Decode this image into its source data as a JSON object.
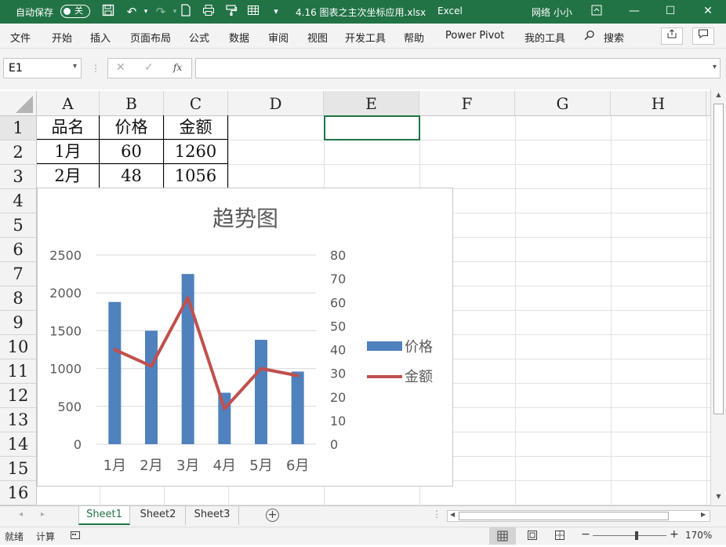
{
  "titlebar": {
    "autosave_label": "自动保存",
    "autosave_state": "关",
    "filename": "4.16 图表之主次坐标应用.xlsx",
    "app": "Excel",
    "user": "网络 小小",
    "color": "#217346"
  },
  "menu": [
    "文件",
    "开始",
    "插入",
    "页面布局",
    "公式",
    "数据",
    "审阅",
    "视图",
    "开发工具",
    "帮助",
    "Power Pivot",
    "我的工具",
    "搜索"
  ],
  "formula_bar": {
    "name_box": "E1",
    "fx": "fx",
    "formula": ""
  },
  "columns": [
    "A",
    "B",
    "C",
    "D",
    "E",
    "F",
    "G",
    "H"
  ],
  "rows": [
    "1",
    "2",
    "3",
    "4",
    "5",
    "6",
    "7",
    "8",
    "9",
    "10",
    "11",
    "12",
    "13",
    "14",
    "15",
    "16"
  ],
  "cells": {
    "A1": "品名",
    "B1": "价格",
    "C1": "金额",
    "A2": "1月",
    "B2": "60",
    "C2": "1260",
    "A3": "2月",
    "B3": "48",
    "C3": "1056"
  },
  "chart_data": {
    "type": "bar",
    "title": "趋势图",
    "categories": [
      "1月",
      "2月",
      "3月",
      "4月",
      "5月",
      "6月"
    ],
    "series": [
      {
        "name": "价格",
        "type": "bar",
        "axis": "primary",
        "values": [
          1880,
          1500,
          2250,
          680,
          1380,
          960
        ],
        "color": "#4f81bd"
      },
      {
        "name": "金额",
        "type": "line",
        "axis": "secondary",
        "values": [
          40,
          33,
          62,
          15,
          32,
          29
        ],
        "color": "#c0504d"
      }
    ],
    "y_primary": {
      "ylim": [
        0,
        2500
      ],
      "ticks": [
        "0",
        "500",
        "1000",
        "1500",
        "2000",
        "2500"
      ]
    },
    "y_secondary": {
      "ylim": [
        0,
        80
      ],
      "ticks": [
        "0",
        "10",
        "20",
        "30",
        "40",
        "50",
        "60",
        "70",
        "80"
      ]
    },
    "legend": "right",
    "grid": true
  },
  "sheets": [
    "Sheet1",
    "Sheet2",
    "Sheet3"
  ],
  "active_sheet": "Sheet1",
  "status": {
    "ready": "就绪",
    "calc": "计算",
    "zoom": "170%"
  }
}
